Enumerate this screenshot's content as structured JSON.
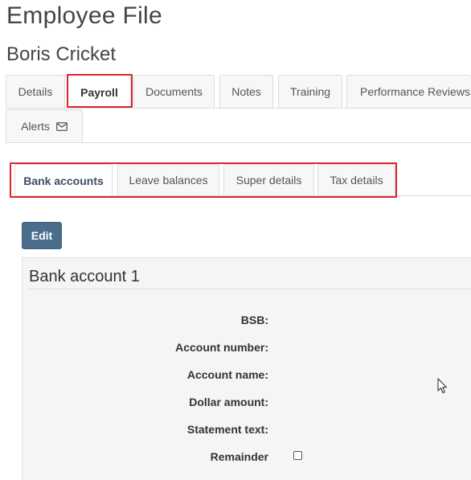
{
  "page": {
    "title": "Employee File",
    "employee_name": "Boris Cricket"
  },
  "main_tabs": [
    {
      "label": "Details"
    },
    {
      "label": "Payroll",
      "active": true
    },
    {
      "label": "Documents"
    },
    {
      "label": "Notes"
    },
    {
      "label": "Training"
    },
    {
      "label": "Performance Reviews"
    },
    {
      "label": "Alerts",
      "icon": "mail-icon"
    }
  ],
  "sub_tabs": [
    {
      "label": "Bank accounts",
      "active": true
    },
    {
      "label": "Leave balances"
    },
    {
      "label": "Super details"
    },
    {
      "label": "Tax details"
    }
  ],
  "actions": {
    "edit_label": "Edit"
  },
  "bank_account": {
    "title": "Bank account 1",
    "fields": [
      {
        "label": "BSB:"
      },
      {
        "label": "Account number:"
      },
      {
        "label": "Account name:"
      },
      {
        "label": "Dollar amount:"
      },
      {
        "label": "Statement text:"
      },
      {
        "label": "Remainder",
        "checked": false
      }
    ]
  },
  "colors": {
    "highlight": "#d9262c",
    "button": "#4a6d8c",
    "panel": "#f5f5f5"
  }
}
